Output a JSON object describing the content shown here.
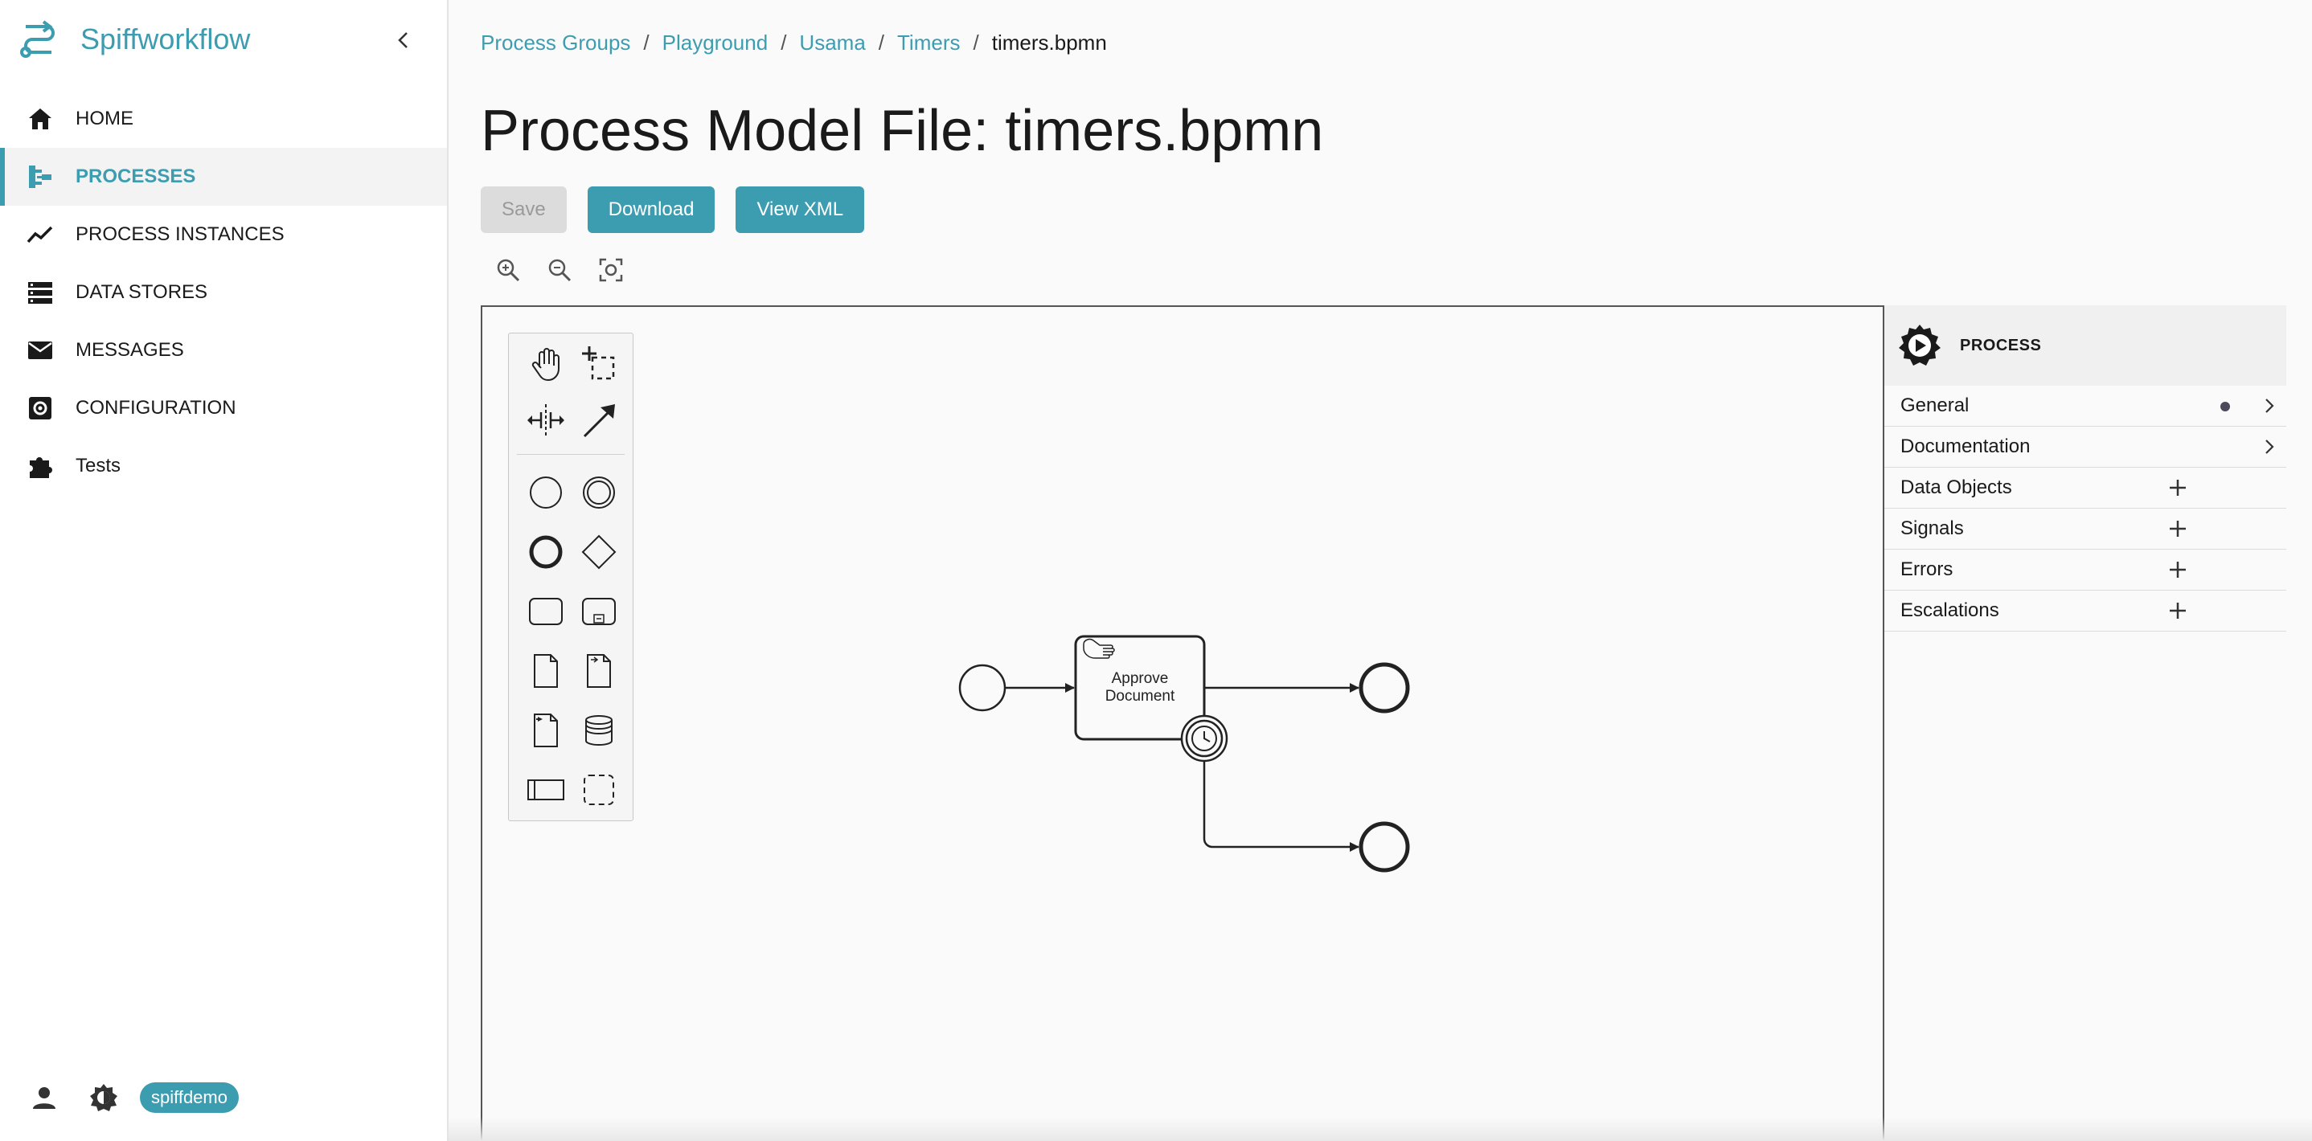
{
  "app": {
    "name": "Spiffworkflow"
  },
  "sidebar": {
    "items": [
      {
        "label": "HOME",
        "icon": "home-icon",
        "active": false
      },
      {
        "label": "PROCESSES",
        "icon": "process-tree-icon",
        "active": true
      },
      {
        "label": "PROCESS INSTANCES",
        "icon": "trend-icon",
        "active": false
      },
      {
        "label": "DATA STORES",
        "icon": "storage-icon",
        "active": false
      },
      {
        "label": "MESSAGES",
        "icon": "envelope-icon",
        "active": false
      },
      {
        "label": "CONFIGURATION",
        "icon": "settings-icon",
        "active": false
      },
      {
        "label": "Tests",
        "icon": "puzzle-icon",
        "active": false
      }
    ],
    "footer": {
      "user": "spiffdemo"
    }
  },
  "breadcrumb": {
    "items": [
      "Process Groups",
      "Playground",
      "Usama",
      "Timers"
    ],
    "current": "timers.bpmn"
  },
  "page": {
    "title": "Process Model File: timers.bpmn"
  },
  "toolbar": {
    "save": "Save",
    "download": "Download",
    "view_xml": "View XML"
  },
  "diagram": {
    "task_label_line1": "Approve",
    "task_label_line2": "Document"
  },
  "properties": {
    "header": "PROCESS",
    "groups": [
      {
        "label": "General",
        "control": "chevron",
        "has_dot": true
      },
      {
        "label": "Documentation",
        "control": "chevron",
        "has_dot": false
      },
      {
        "label": "Data Objects",
        "control": "plus",
        "has_dot": false
      },
      {
        "label": "Signals",
        "control": "plus",
        "has_dot": false
      },
      {
        "label": "Errors",
        "control": "plus",
        "has_dot": false
      },
      {
        "label": "Escalations",
        "control": "plus",
        "has_dot": false
      }
    ]
  },
  "colors": {
    "accent": "#3c9db1",
    "disabled": "#dcdcdc"
  }
}
